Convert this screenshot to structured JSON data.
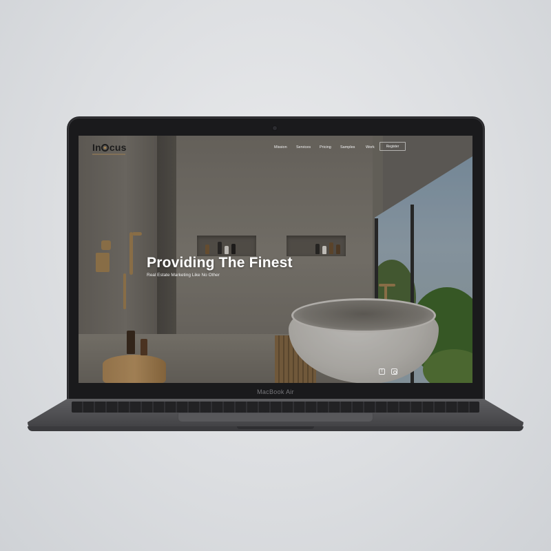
{
  "device": {
    "model_label": "MacBook Air"
  },
  "site": {
    "logo": {
      "text_prefix": "In",
      "text_suffix": "cus",
      "accent_color": "#b38a4f"
    },
    "nav": [
      {
        "label": "Mission"
      },
      {
        "label": "Services"
      },
      {
        "label": "Pricing"
      },
      {
        "label": "Samples"
      },
      {
        "label": "Work"
      }
    ],
    "register_label": "Register",
    "hero": {
      "title": "Providing The Finest",
      "subtitle": "Real Estate Marketing Like No Other"
    },
    "social": [
      {
        "icon": "facebook-icon"
      },
      {
        "icon": "instagram-icon"
      }
    ]
  },
  "colors": {
    "background": "#dcdee1",
    "laptop_body": "#4c4c4f",
    "bezel": "#1a1a1c",
    "hero_text": "#ffffff",
    "brass_accent": "#a88654"
  }
}
